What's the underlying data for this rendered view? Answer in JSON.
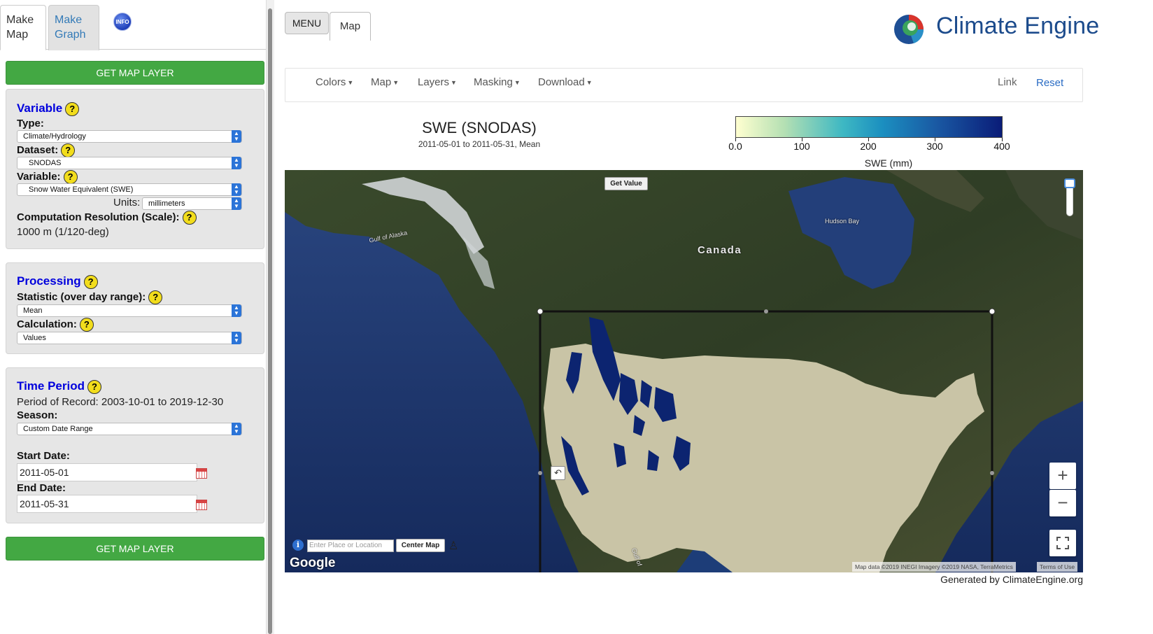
{
  "sidebar": {
    "tabs": {
      "make_map": "Make\nMap",
      "make_graph": "Make\nGraph",
      "info": "INFO"
    },
    "get_map_layer_top": "GET MAP LAYER",
    "get_map_layer_bottom": "GET MAP LAYER",
    "variable_panel": {
      "title": "Variable",
      "type_label": "Type:",
      "type_value": "Climate/Hydrology",
      "dataset_label": "Dataset:",
      "dataset_value": "SNODAS",
      "variable_label": "Variable:",
      "variable_value": "Snow Water Equivalent (SWE)",
      "units_label": "Units:",
      "units_value": "millimeters",
      "resolution_label": "Computation Resolution (Scale):",
      "resolution_value": "1000 m (1/120-deg)"
    },
    "processing_panel": {
      "title": "Processing",
      "statistic_label": "Statistic (over day range):",
      "statistic_value": "Mean",
      "calculation_label": "Calculation:",
      "calculation_value": "Values"
    },
    "time_panel": {
      "title": "Time Period",
      "period_of_record": "Period of Record: 2003-10-01 to 2019-12-30",
      "season_label": "Season:",
      "season_value": "Custom Date Range",
      "start_label": "Start Date:",
      "start_value": "2011-05-01",
      "end_label": "End Date:",
      "end_value": "2011-05-31"
    },
    "help_glyph": "?"
  },
  "header": {
    "menu_button": "MENU",
    "map_tab": "Map",
    "brand": "Climate Engine"
  },
  "navbar": {
    "items": [
      "Colors",
      "Map",
      "Layers",
      "Masking",
      "Download"
    ],
    "link": "Link",
    "reset": "Reset"
  },
  "map_header": {
    "title": "SWE (SNODAS)",
    "subtitle": "2011-05-01 to 2011-05-31, Mean"
  },
  "legend": {
    "ticks": [
      "0.0",
      "100",
      "200",
      "300",
      "400"
    ],
    "units": "SWE (mm)",
    "colors": [
      "#ffffd0",
      "#b5e0b3",
      "#3eb8c3",
      "#1a5aa4",
      "#0a1c78"
    ]
  },
  "map": {
    "labels": {
      "canada": "Canada",
      "hudson_bay": "Hudson Bay",
      "gulf_alaska": "Gulf of Alaska",
      "gulf_small": "Gulf of"
    },
    "get_value": "Get Value",
    "zoom_in": "+",
    "zoom_out": "−",
    "place_placeholder": "Enter Place or Location",
    "center_map": "Center Map",
    "google": "Google",
    "attribution": "Map data ©2019 INEGI Imagery ©2019 NASA, TerraMetrics",
    "terms": "Terms of Use",
    "icons": [
      "info-icon",
      "person-icon",
      "undo-icon",
      "fullscreen-icon"
    ]
  },
  "footer": {
    "generated": "Generated by ClimateEngine.org"
  }
}
